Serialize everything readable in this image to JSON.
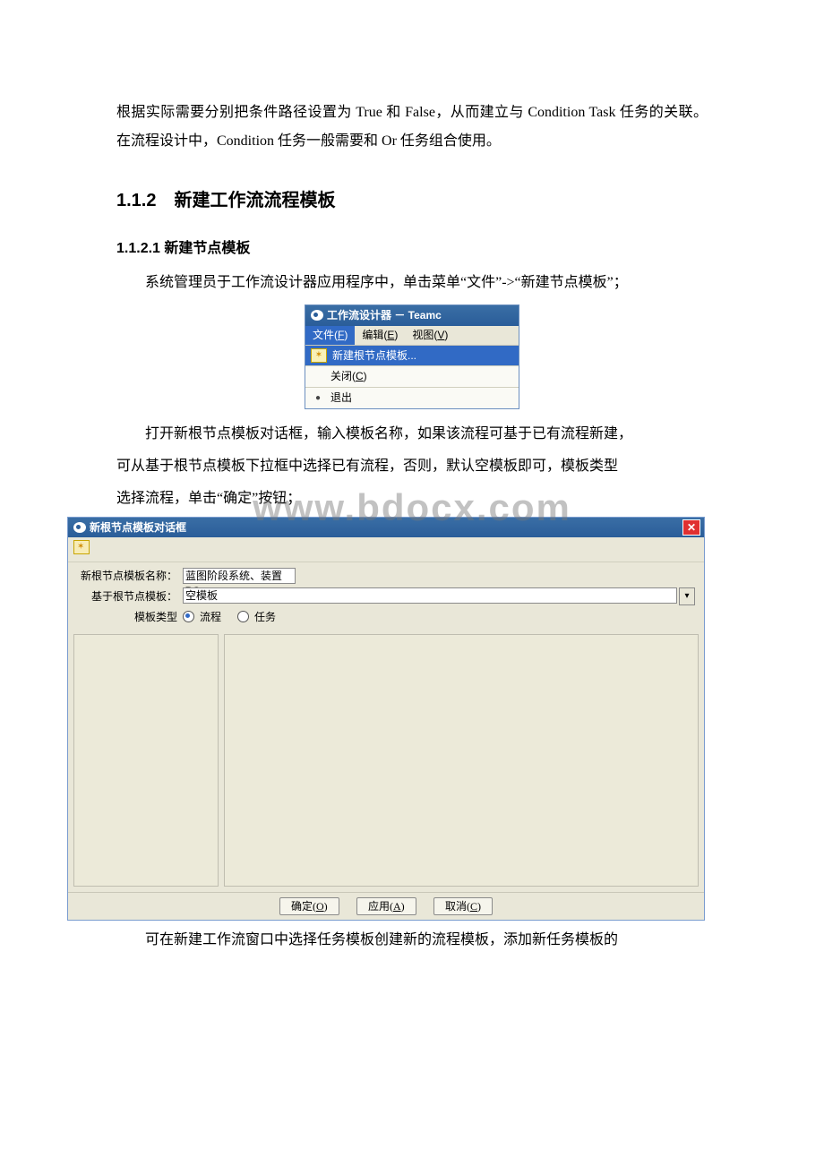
{
  "body": {
    "p1": "根据实际需要分别把条件路径设置为 True 和 False，从而建立与 Condition Task 任务的关联。在流程设计中，Condition 任务一般需要和 Or 任务组合使用。",
    "h2": "1.1.2　新建工作流流程模板",
    "h3": "1.1.2.1 新建节点模板",
    "p2": "系统管理员于工作流设计器应用程序中，单击菜单“文件”->“新建节点模板”；",
    "p3": "打开新根节点模板对话框，输入模板名称，如果该流程可基于已有流程新建，可从基于根节点模板下拉框中选择已有流程，否则，默认空模板即可，模板类型选择流程，单击“确定”按钮；",
    "p4": "可在新建工作流窗口中选择任务模板创建新的流程模板，添加新任务模板的"
  },
  "watermark": "www.bdocx.com",
  "menu_fig": {
    "title": "工作流设计器 － Teamc",
    "menubar": {
      "file": "文件(F)",
      "edit": "编辑(E)",
      "view": "视图(V)"
    },
    "items": {
      "new_template": "新建根节点模板...",
      "close": "关闭(C)",
      "exit": "退出"
    }
  },
  "dialog": {
    "title": "新根节点模板对话框",
    "labels": {
      "name": "新根节点模板名称：",
      "based_on": "基于根节点模板：",
      "type": "模板类型"
    },
    "values": {
      "name": "蓝图阶段系统、装置BO",
      "based_on": "空模板"
    },
    "radios": {
      "flow": "流程",
      "task": "任务"
    },
    "buttons": {
      "ok": "确定(O)",
      "apply": "应用(A)",
      "cancel": "取消(C)"
    }
  }
}
